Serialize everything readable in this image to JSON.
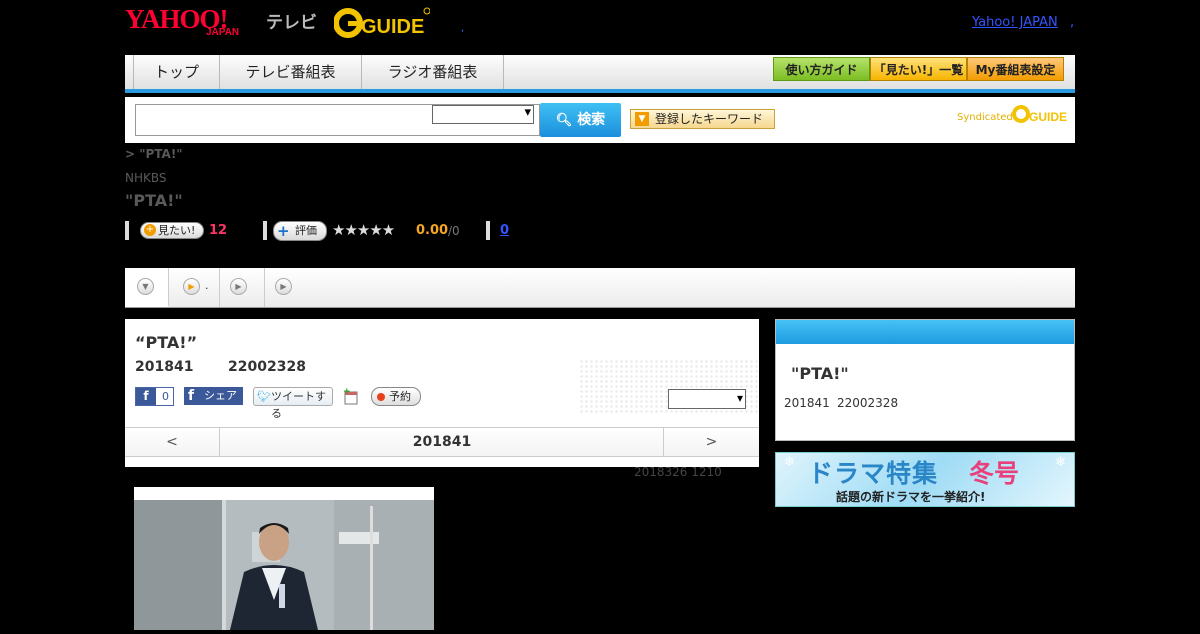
{
  "header": {
    "yahoo_logo": "YAHOO!",
    "japan_logo": "JAPAN",
    "tv_label": "テレビ",
    "gguide_logo": "G-GUIDE",
    "sep": ",",
    "yahoo_japan_link": "Yahoo! JAPAN",
    "yahoo_japan_sep": ","
  },
  "nav": {
    "tabs": [
      "トップ",
      "テレビ番組表",
      "ラジオ番組表"
    ],
    "buttons": [
      "使い方ガイド",
      "「見たい!」一覧",
      "My番組表設定"
    ]
  },
  "search": {
    "input_value": "",
    "select_value": "",
    "button_label": "検索",
    "keyword_button": "登録したキーワード",
    "syndicated": "Syndicated",
    "gguide_small": "GUIDE"
  },
  "program": {
    "breadcrumb": "> \"PTA!\"",
    "station": "NHKBS",
    "title": "\"PTA!\"",
    "want_button": "見たい!",
    "want_count": "12",
    "rate_button": "評価",
    "rating_stars": "★★★★★",
    "rating_value": "0.00",
    "rating_total": "/0",
    "review_count": "0"
  },
  "tabs": [
    {
      "icon": "down-arrow-icon",
      "label": ""
    },
    {
      "icon": "play-icon",
      "label": "."
    },
    {
      "icon": "play-icon",
      "label": ""
    },
    {
      "icon": "play-icon",
      "label": ""
    }
  ],
  "detail": {
    "title": "“PTA!”",
    "date": "201841",
    "time": "22002328",
    "like_count": "0",
    "share_label": "シェア",
    "tweet_label": "ツイートする",
    "reserve_label": "予約",
    "select_value": "",
    "prev": "<",
    "current_date": "201841",
    "next": ">",
    "updated": "2018326  1210"
  },
  "sidebar": {
    "title": "\"PTA!\"",
    "date": "201841",
    "time": "22002328"
  },
  "banner": {
    "title_part1": "ドラマ特集",
    "title_part2": "冬号",
    "subtitle": "話題の新ドラマを一挙紹介!"
  },
  "colors": {
    "accent_blue": "#2b9be0",
    "want_count": "#ff3366",
    "rating_value": "#f5a623",
    "link_blue": "#3355ff"
  }
}
